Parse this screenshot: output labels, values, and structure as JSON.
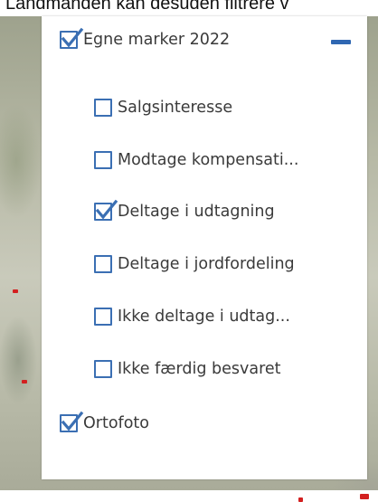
{
  "caption": "Landmanden kan desuden filtrere v",
  "colors": {
    "accent": "#3b6fb3",
    "text": "#3a3a3a",
    "marker": "#d32020"
  },
  "layers": {
    "group": {
      "label": "Egne marker 2022",
      "checked": true,
      "collapse_icon": "minus-icon"
    },
    "items": [
      {
        "label": "Salgsinteresse",
        "checked": false
      },
      {
        "label": "Modtage kompensati...",
        "checked": false
      },
      {
        "label": "Deltage i udtagning",
        "checked": true
      },
      {
        "label": "Deltage i jordfordeling",
        "checked": false
      },
      {
        "label": "Ikke deltage i udtag...",
        "checked": false
      },
      {
        "label": "Ikke færdig besvaret",
        "checked": false
      }
    ],
    "ortofoto": {
      "label": "Ortofoto",
      "checked": true
    }
  }
}
